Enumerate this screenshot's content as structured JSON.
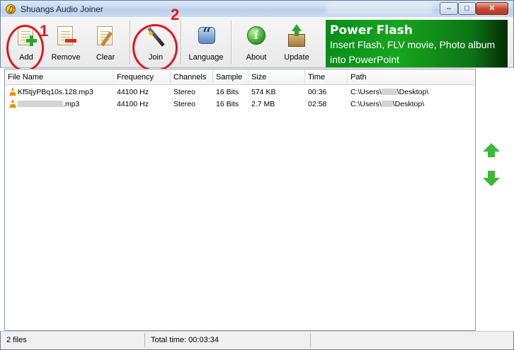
{
  "window": {
    "title": "Shuangs Audio Joiner"
  },
  "title_buttons": {
    "minimize": "–",
    "maximize": "□",
    "close": "✕"
  },
  "toolbar": {
    "add": "Add",
    "remove": "Remove",
    "clear": "Clear",
    "join": "Join",
    "language": "Language",
    "about": "About",
    "update": "Update"
  },
  "annotations": {
    "step1": "1",
    "step2": "2"
  },
  "banner": {
    "title": "Power Flash",
    "line1": "Insert Flash, FLV movie, Photo album",
    "line2": "into PowerPoint"
  },
  "table": {
    "columns": [
      "File Name",
      "Frequency",
      "Channels",
      "Sample",
      "Size",
      "Time",
      "Path"
    ],
    "rows": [
      [
        "Kf5tjyPBq10s.128.mp3",
        "44100 Hz",
        "Stereo",
        "16 Bits",
        "574 KB",
        "00:36",
        "C:\\Users\\",
        "\\Desktop\\"
      ],
      [
        ".mp3",
        "44100 Hz",
        "Stereo",
        "16 Bits",
        "2.7 MB",
        "02:58",
        "C:\\Users\\",
        "\\Desktop\\"
      ]
    ]
  },
  "status": {
    "files": "2 files",
    "total_time": "Total time: 00:03:34"
  },
  "icons": {
    "add": "add-file-icon",
    "remove": "remove-file-icon",
    "clear": "clear-icon",
    "join": "join-wand-icon",
    "language": "language-icon",
    "about": "about-info-icon",
    "update": "update-icon",
    "move_up": "arrow-up-icon",
    "move_down": "arrow-down-icon",
    "vlc": "vlc-cone-icon"
  },
  "colors": {
    "annotation": "#e4151b",
    "banner": "#17a51f",
    "arrows": "#3fb83a"
  }
}
